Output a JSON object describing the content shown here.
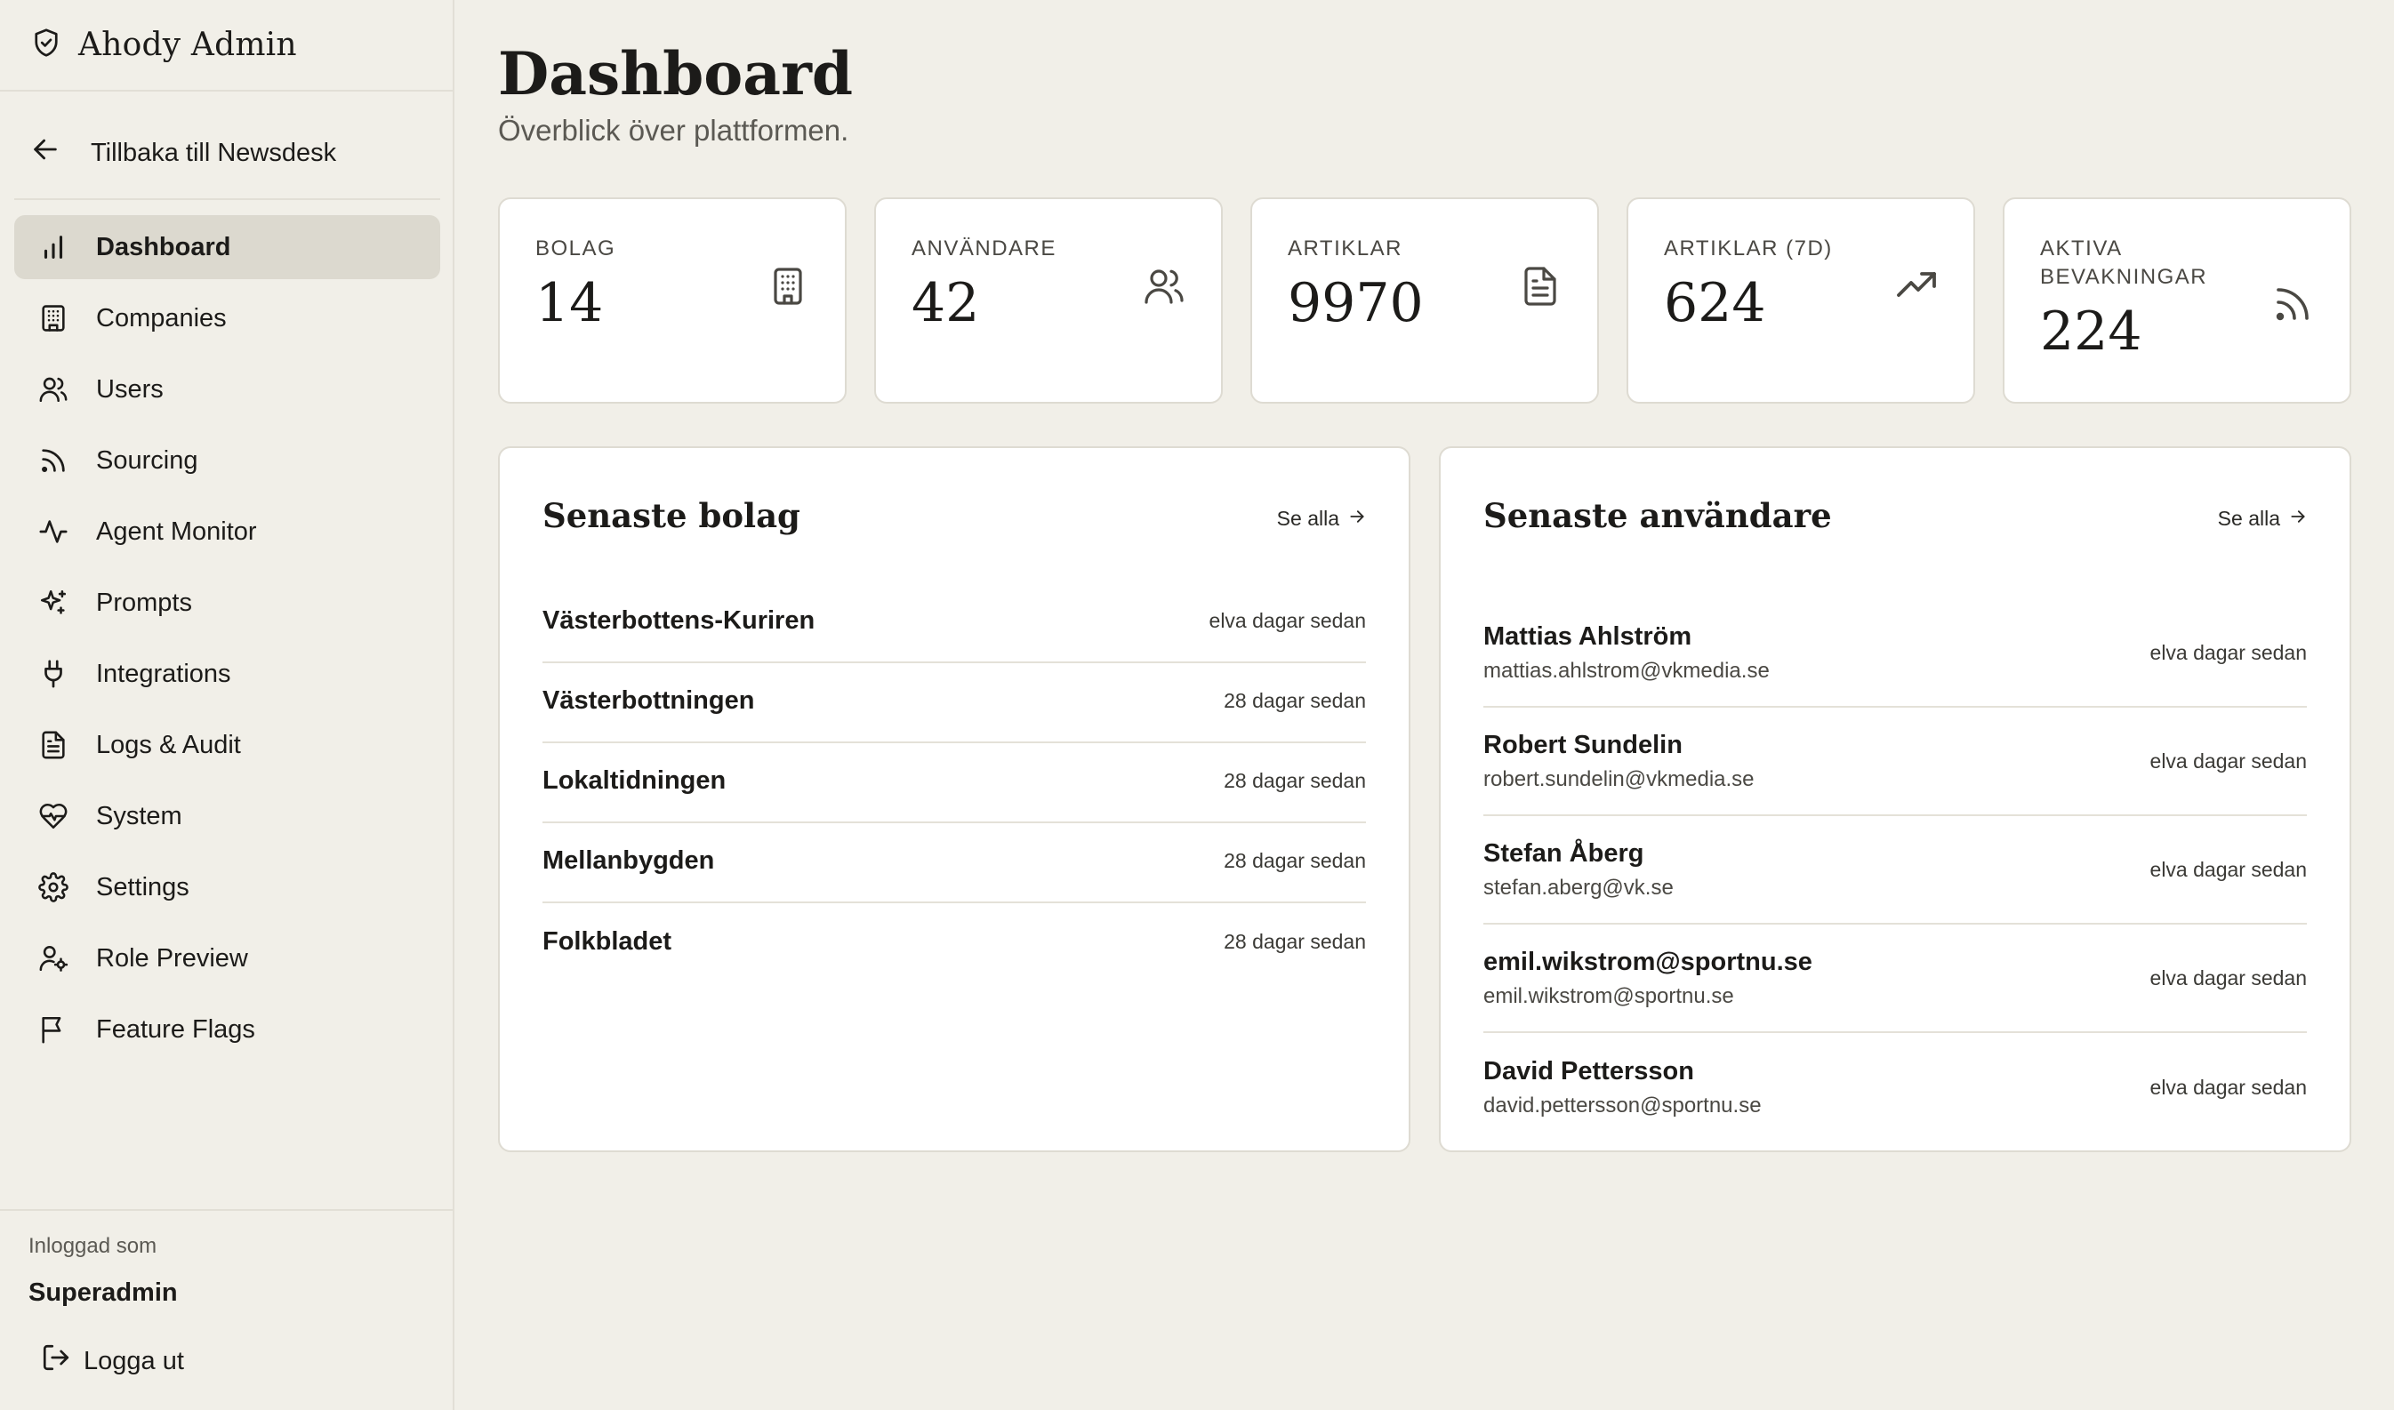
{
  "app": {
    "title": "Ahody Admin"
  },
  "sidebar": {
    "back_label": "Tillbaka till Newsdesk",
    "items": [
      {
        "label": "Dashboard",
        "icon": "bar-chart-icon",
        "active": true
      },
      {
        "label": "Companies",
        "icon": "building-icon"
      },
      {
        "label": "Users",
        "icon": "users-icon"
      },
      {
        "label": "Sourcing",
        "icon": "rss-icon"
      },
      {
        "label": "Agent Monitor",
        "icon": "activity-icon"
      },
      {
        "label": "Prompts",
        "icon": "sparkles-icon"
      },
      {
        "label": "Integrations",
        "icon": "plug-icon"
      },
      {
        "label": "Logs & Audit",
        "icon": "file-text-icon"
      },
      {
        "label": "System",
        "icon": "heart-pulse-icon"
      },
      {
        "label": "Settings",
        "icon": "gear-icon"
      },
      {
        "label": "Role Preview",
        "icon": "user-cog-icon"
      },
      {
        "label": "Feature Flags",
        "icon": "flag-icon"
      }
    ],
    "footer": {
      "logged_in_label": "Inloggad som",
      "user": "Superadmin",
      "logout_label": "Logga ut"
    }
  },
  "header": {
    "title": "Dashboard",
    "subtitle": "Överblick över plattformen."
  },
  "stats": [
    {
      "label": "BOLAG",
      "value": "14",
      "icon": "building-icon"
    },
    {
      "label": "ANVÄNDARE",
      "value": "42",
      "icon": "users-icon"
    },
    {
      "label": "ARTIKLAR",
      "value": "9970",
      "icon": "file-text-icon"
    },
    {
      "label": "ARTIKLAR (7D)",
      "value": "624",
      "icon": "trending-up-icon"
    },
    {
      "label": "AKTIVA BEVAKNINGAR",
      "value": "224",
      "icon": "rss-icon"
    }
  ],
  "companies_card": {
    "title": "Senaste bolag",
    "see_all": "Se alla",
    "rows": [
      {
        "name": "Västerbottens-Kuriren",
        "time": "elva dagar sedan"
      },
      {
        "name": "Västerbottningen",
        "time": "28 dagar sedan"
      },
      {
        "name": "Lokaltidningen",
        "time": "28 dagar sedan"
      },
      {
        "name": "Mellanbygden",
        "time": "28 dagar sedan"
      },
      {
        "name": "Folkbladet",
        "time": "28 dagar sedan"
      }
    ]
  },
  "users_card": {
    "title": "Senaste användare",
    "see_all": "Se alla",
    "rows": [
      {
        "name": "Mattias Ahlström",
        "email": "mattias.ahlstrom@vkmedia.se",
        "time": "elva dagar sedan"
      },
      {
        "name": "Robert Sundelin",
        "email": "robert.sundelin@vkmedia.se",
        "time": "elva dagar sedan"
      },
      {
        "name": "Stefan Åberg",
        "email": "stefan.aberg@vk.se",
        "time": "elva dagar sedan"
      },
      {
        "name": "emil.wikstrom@sportnu.se",
        "email": "emil.wikstrom@sportnu.se",
        "time": "elva dagar sedan"
      },
      {
        "name": "David Pettersson",
        "email": "david.pettersson@sportnu.se",
        "time": "elva dagar sedan"
      }
    ]
  },
  "colors": {
    "background": "#f1efe8",
    "card": "#ffffff",
    "active_nav": "#dcd9cf",
    "border": "#dedbd2",
    "text": "#1c1b19",
    "muted": "#5b5953"
  }
}
